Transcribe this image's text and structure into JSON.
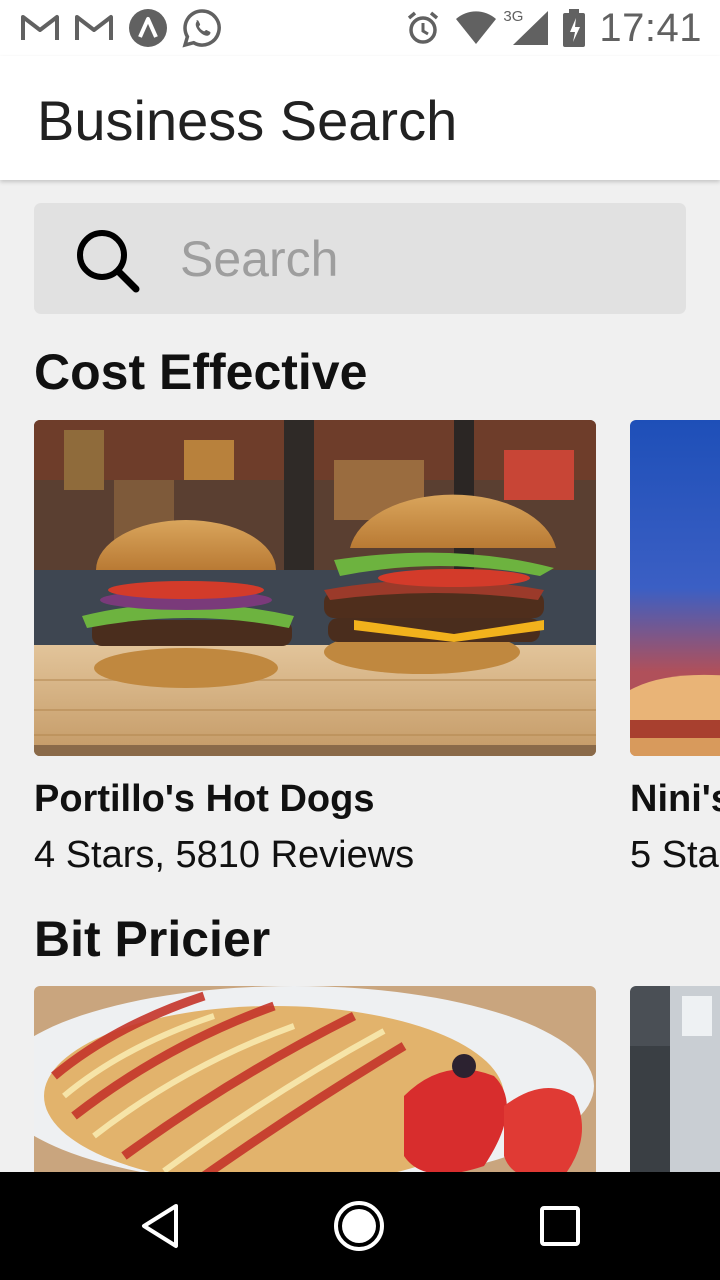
{
  "status_bar": {
    "left_icons": [
      "gmail-icon",
      "gmail-icon",
      "arc-app-icon",
      "whatsapp-icon"
    ],
    "right_icons": [
      "alarm-icon",
      "wifi-icon",
      "cell-signal-icon",
      "battery-charging-icon"
    ],
    "network_label": "3G",
    "time": "17:41"
  },
  "app_bar": {
    "title": "Business Search"
  },
  "search": {
    "placeholder": "Search",
    "value": ""
  },
  "sections": [
    {
      "title": "Cost Effective",
      "cards": [
        {
          "name": "Portillo's Hot Dogs",
          "meta": "4 Stars, 5810 Reviews",
          "image": "burgers-photo"
        },
        {
          "name": "Nini's",
          "meta": "5 Sta",
          "image": "sandwich-photo"
        }
      ]
    },
    {
      "title": "Bit Pricier",
      "cards": [
        {
          "name": "",
          "meta": "",
          "image": "french-toast-photo"
        },
        {
          "name": "",
          "meta": "",
          "image": "bottle-photo"
        }
      ]
    }
  ],
  "nav_bar": {
    "buttons": [
      "back-icon",
      "home-icon",
      "recents-icon"
    ]
  },
  "colors": {
    "app_bar": "#ffffff",
    "background": "#f0f0f0",
    "search_box": "#e1e1e1",
    "status_icons": "#616161"
  }
}
